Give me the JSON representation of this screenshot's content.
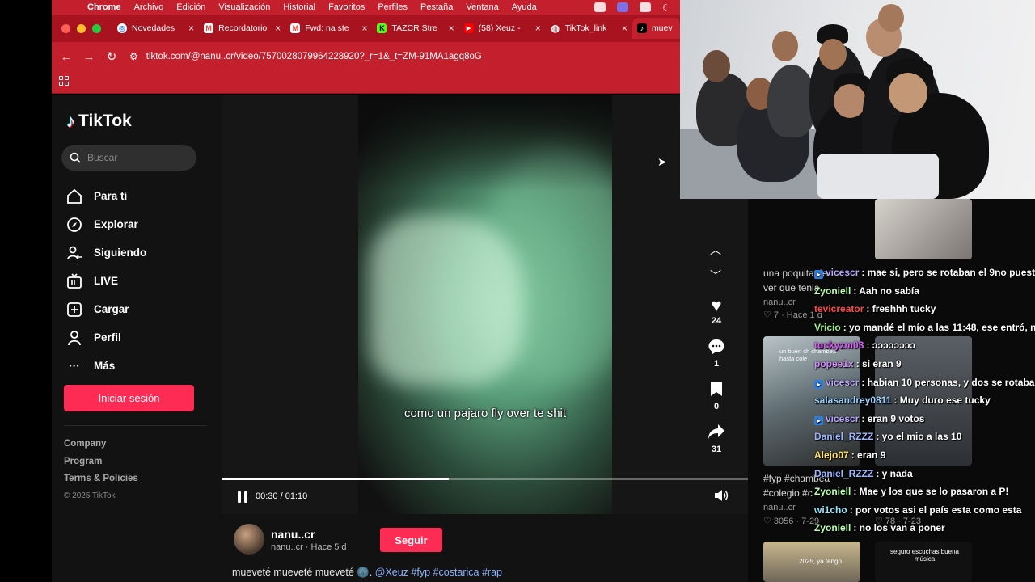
{
  "menubar": {
    "items": [
      "Chrome",
      "Archivo",
      "Edición",
      "Visualización",
      "Historial",
      "Favoritos",
      "Perfiles",
      "Pestaña",
      "Ventana",
      "Ayuda"
    ]
  },
  "tabs": [
    {
      "label": "Novedades",
      "icon": "chrome-icon",
      "color": "#ffffff"
    },
    {
      "label": "Recordatorio",
      "icon": "gmail-icon",
      "color": "#ea4335"
    },
    {
      "label": "Fwd: na ste",
      "icon": "gmail-icon",
      "color": "#ea4335"
    },
    {
      "label": "TAZCR Stre",
      "icon": "kick-icon",
      "color": "#53fc18"
    },
    {
      "label": "(58) Xeuz -",
      "icon": "youtube-icon",
      "color": "#ff0000"
    },
    {
      "label": "TikTok_link",
      "icon": "globe-icon",
      "color": "#ffffff"
    },
    {
      "label": "muev",
      "icon": "tiktok-icon",
      "color": "#ffffff"
    }
  ],
  "address": {
    "url": "tiktok.com/@nanu..cr/video/7570028079964228920?_r=1&_t=ZM-91MA1agq8oG"
  },
  "tiktok": {
    "logo": "TikTok",
    "search_placeholder": "Buscar",
    "nav": [
      {
        "label": "Para ti",
        "icon": "home-icon"
      },
      {
        "label": "Explorar",
        "icon": "compass-icon"
      },
      {
        "label": "Siguiendo",
        "icon": "following-icon"
      },
      {
        "label": "LIVE",
        "icon": "live-tv-icon"
      },
      {
        "label": "Cargar",
        "icon": "upload-icon"
      },
      {
        "label": "Perfil",
        "icon": "profile-icon"
      },
      {
        "label": "Más",
        "icon": "more-icon"
      }
    ],
    "login_label": "Iniciar sesión",
    "footer": [
      "Company",
      "Program",
      "Terms & Policies"
    ],
    "copyright": "© 2025 TikTok",
    "video": {
      "subtitle": "como un pajaro fly over te shit",
      "time": "00:30 / 01:10",
      "progress": 0.43
    },
    "actions": {
      "likes": "24",
      "comments": "1",
      "saves": "0",
      "shares": "31"
    },
    "author": {
      "name": "nanu..cr",
      "meta": "nanu..cr · Hace 5 d",
      "follow_label": "Seguir"
    },
    "description": "mueveté mueveté mueveté 🌚.",
    "description_tags": "@Xeuz #fyp #costarica #rap"
  },
  "feed": {
    "cards": [
      {
        "caption": "una poquita de ver que tenia...",
        "author": "nanu..cr",
        "meta": "♡ 7 · Hace 1 d"
      },
      {
        "caption": "#fyp #chambea #colegio #c",
        "author": "nanu..cr",
        "meta": "♡ 3056 · 7-29"
      }
    ],
    "right_meta": "♡ 78 · 7-23",
    "thumb_text": [
      "un buen ch chambea hasta cole",
      "2025, ya tengo",
      "seguro escuchas buena música"
    ]
  },
  "chat": [
    {
      "user": "vicescr",
      "color": "#b9a8ff",
      "badge": true,
      "text": ": mae si, pero se rotaban el 9no puesto"
    },
    {
      "user": "Zyoniell",
      "color": "#b9ffb0",
      "badge": false,
      "text": ": Aah no sabía"
    },
    {
      "user": "tevicreator",
      "color": "#ff4a4a",
      "badge": false,
      "text": ": freshhh tucky"
    },
    {
      "user": "Vricio",
      "color": "#9ef08a",
      "badge": false,
      "text": ": yo mandé el mío a las 11:48, ese entró, no?"
    },
    {
      "user": "tuckyzm03",
      "color": "#e05cff",
      "badge": false,
      "text": ": ͻͻͻͻͻͻͻͻ"
    },
    {
      "user": "popee1x",
      "color": "#d58cff",
      "badge": false,
      "text": ": si eran 9"
    },
    {
      "user": "vicescr",
      "color": "#b9a8ff",
      "badge": true,
      "text": ": habian 10 personas, y dos se rotaban"
    },
    {
      "user": "salasandrey0811",
      "color": "#9fd2ff",
      "badge": false,
      "text": ": Muy duro ese tucky"
    },
    {
      "user": "vicescr",
      "color": "#b9a8ff",
      "badge": true,
      "text": ": eran 9 votos"
    },
    {
      "user": "Daniel_RZZZ",
      "color": "#9fb6ff",
      "badge": false,
      "text": ": yo el mio a las 10"
    },
    {
      "user": "Alejo07",
      "color": "#ffe36a",
      "badge": false,
      "text": ": eran 9"
    },
    {
      "user": "Daniel_RZZZ",
      "color": "#9fb6ff",
      "badge": false,
      "text": ": y nada"
    },
    {
      "user": "Zyoniell",
      "color": "#b9ffb0",
      "badge": false,
      "text": ": Mae y los que se lo pasaron a P!"
    },
    {
      "user": "wi1cho",
      "color": "#8ee6ff",
      "badge": false,
      "text": ": por votos asi el país esta como esta"
    },
    {
      "user": "Zyoniell",
      "color": "#b9ffb0",
      "badge": false,
      "text": ": no los van a poner"
    }
  ]
}
